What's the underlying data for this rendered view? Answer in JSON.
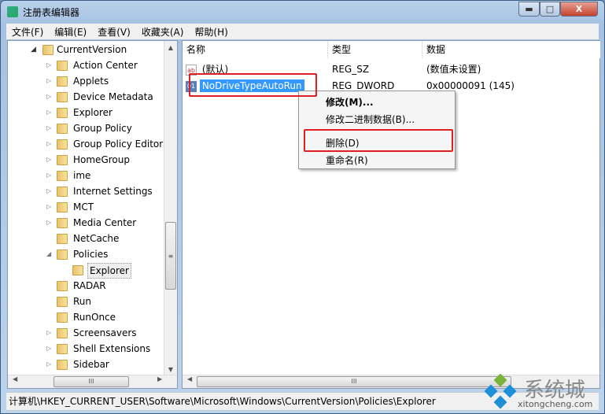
{
  "window": {
    "title": "注册表编辑器",
    "minimize": "▬",
    "maximize": "□",
    "close": "X"
  },
  "menu": [
    "文件(F)",
    "编辑(E)",
    "查看(V)",
    "收藏夹(A)",
    "帮助(H)"
  ],
  "tree": {
    "parent": "CurrentVersion",
    "items": [
      {
        "label": "Action Center",
        "arrow": "▷"
      },
      {
        "label": "Applets",
        "arrow": "▷"
      },
      {
        "label": "Device Metadata",
        "arrow": "▷"
      },
      {
        "label": "Explorer",
        "arrow": "▷"
      },
      {
        "label": "Group Policy",
        "arrow": "▷"
      },
      {
        "label": "Group Policy Editor",
        "arrow": "▷"
      },
      {
        "label": "HomeGroup",
        "arrow": "▷"
      },
      {
        "label": "ime",
        "arrow": "▷"
      },
      {
        "label": "Internet Settings",
        "arrow": "▷"
      },
      {
        "label": "MCT",
        "arrow": "▷"
      },
      {
        "label": "Media Center",
        "arrow": "▷"
      },
      {
        "label": "NetCache",
        "arrow": ""
      },
      {
        "label": "Policies",
        "arrow": "◢"
      },
      {
        "label": "Explorer",
        "arrow": "",
        "child": true,
        "selected": true
      },
      {
        "label": "RADAR",
        "arrow": ""
      },
      {
        "label": "Run",
        "arrow": ""
      },
      {
        "label": "RunOnce",
        "arrow": ""
      },
      {
        "label": "Screensavers",
        "arrow": "▷"
      },
      {
        "label": "Shell Extensions",
        "arrow": "▷"
      },
      {
        "label": "Sidebar",
        "arrow": "▷"
      }
    ]
  },
  "list": {
    "columns": [
      "名称",
      "类型",
      "数据"
    ],
    "rows": [
      {
        "icon": "string-value-icon",
        "name": "(默认)",
        "type": "REG_SZ",
        "data": "(数值未设置)"
      },
      {
        "icon": "dword-value-icon",
        "name": "NoDriveTypeAutoRun",
        "type": "REG_DWORD",
        "data": "0x00000091 (145)",
        "selected": true
      }
    ]
  },
  "context_menu": [
    "修改(M)...",
    "修改二进制数据(B)...",
    "删除(D)",
    "重命名(R)"
  ],
  "status": "计算机\\HKEY_CURRENT_USER\\Software\\Microsoft\\Windows\\CurrentVersion\\Policies\\Explorer",
  "watermark": {
    "text": "系统城",
    "url": "xitongcheng.com"
  },
  "colors": {
    "highlight": "#3399ff",
    "annotation": "#e02020"
  }
}
